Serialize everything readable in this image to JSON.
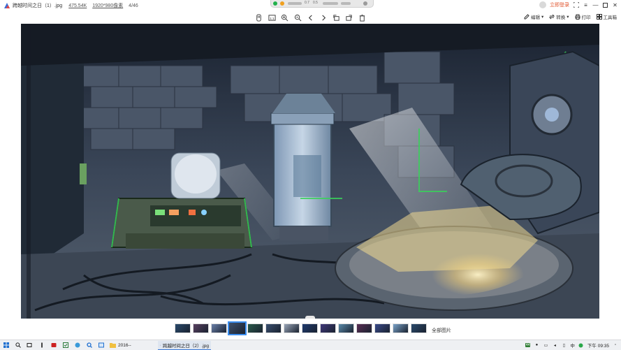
{
  "app": {
    "title": "跨越时间之日（1）.jpg",
    "file_size": "475.54K",
    "dimensions": "1920*980像素",
    "index": "4/46",
    "login_label": "立即登录"
  },
  "toolbar": {
    "edit_label": "编辑",
    "convert_label": "转换",
    "print_label": "打印",
    "toolbox_label": "工具箱"
  },
  "float_bar": {
    "labels": [
      "0.7",
      "0.5"
    ]
  },
  "filmstrip": {
    "all_photos_label": "全部图片",
    "thumb_colors": [
      "#2a4a6c",
      "#5a4060",
      "#6a7fa8",
      "#3d4f6a",
      "#2a5a4a",
      "#3a5070",
      "#9aa6b8",
      "#1f3a70",
      "#40387a",
      "#5a8aaa",
      "#5a2e54",
      "#3a4a8a",
      "#7aa2c8"
    ],
    "selected_index": 3
  },
  "taskbar": {
    "folder_task": "2016--",
    "viewer_task": "跨越时间之日（2）.jpg",
    "ime_label": "中",
    "clock": "下午 09:35",
    "temp_badge": "44"
  }
}
